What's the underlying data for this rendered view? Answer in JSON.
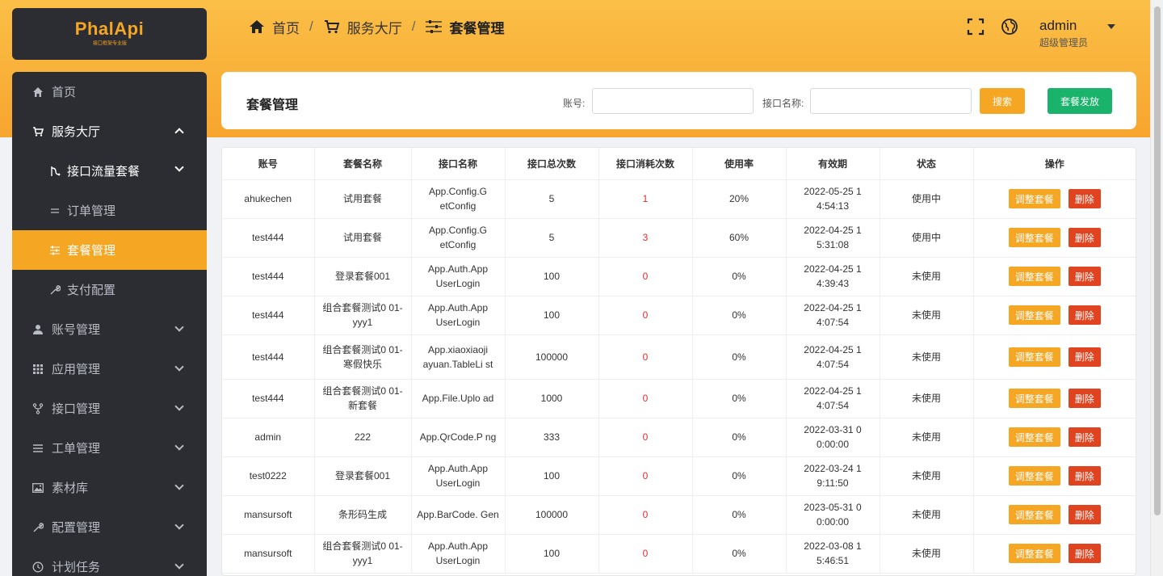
{
  "logo": {
    "main": "PhalApi",
    "sub": "接口框架专业版"
  },
  "menu": {
    "items": [
      {
        "label": "首页",
        "icon": "home-icon"
      },
      {
        "label": "服务大厅",
        "icon": "cart-icon"
      },
      {
        "label": "接口流量套餐",
        "icon": "flow-icon"
      },
      {
        "label": "订单管理",
        "icon": "lines-icon"
      },
      {
        "label": "套餐管理",
        "icon": "sliders-icon"
      },
      {
        "label": "支付配置",
        "icon": "wrench-icon"
      },
      {
        "label": "账号管理",
        "icon": "user-icon"
      },
      {
        "label": "应用管理",
        "icon": "grid-icon"
      },
      {
        "label": "接口管理",
        "icon": "branch-icon"
      },
      {
        "label": "工单管理",
        "icon": "list-icon"
      },
      {
        "label": "素材库",
        "icon": "image-icon"
      },
      {
        "label": "配置管理",
        "icon": "wrench-icon"
      },
      {
        "label": "计划任务",
        "icon": "clock-icon"
      }
    ]
  },
  "breadcrumb": {
    "home": "首页",
    "hall": "服务大厅",
    "current": "套餐管理",
    "sep": "/"
  },
  "user": {
    "name": "admin",
    "role": "超级管理员"
  },
  "card": {
    "title": "套餐管理",
    "account_label": "账号:",
    "api_label": "接口名称:",
    "account_value": "",
    "api_value": "",
    "search_btn": "搜索",
    "issue_btn": "套餐发放"
  },
  "table": {
    "headers": [
      "账号",
      "套餐名称",
      "接口名称",
      "接口总次数",
      "接口消耗次数",
      "使用率",
      "有效期",
      "状态",
      "操作"
    ],
    "adjust_label": "调整套餐",
    "delete_label": "删除",
    "rows": [
      {
        "account": "ahukechen",
        "plan": "试用套餐",
        "api": "App.Config.G etConfig",
        "total": "5",
        "used": "1",
        "rate": "20%",
        "expire": "2022-05-25 1 4:54:13",
        "status": "使用中"
      },
      {
        "account": "test444",
        "plan": "试用套餐",
        "api": "App.Config.G etConfig",
        "total": "5",
        "used": "3",
        "rate": "60%",
        "expire": "2022-04-25 1 5:31:08",
        "status": "使用中"
      },
      {
        "account": "test444",
        "plan": "登录套餐001",
        "api": "App.Auth.App UserLogin",
        "total": "100",
        "used": "0",
        "rate": "0%",
        "expire": "2022-04-25 1 4:39:43",
        "status": "未使用"
      },
      {
        "account": "test444",
        "plan": "组合套餐测试0 01-yyy1",
        "api": "App.Auth.App UserLogin",
        "total": "100",
        "used": "0",
        "rate": "0%",
        "expire": "2022-04-25 1 4:07:54",
        "status": "未使用"
      },
      {
        "account": "test444",
        "plan": "组合套餐测试0 01-寒假快乐",
        "api": "App.xiaoxiaoji ayuan.TableLi st",
        "total": "100000",
        "used": "0",
        "rate": "0%",
        "expire": "2022-04-25 1 4:07:54",
        "status": "未使用"
      },
      {
        "account": "test444",
        "plan": "组合套餐测试0 01-新套餐",
        "api": "App.File.Uplo ad",
        "total": "1000",
        "used": "0",
        "rate": "0%",
        "expire": "2022-04-25 1 4:07:54",
        "status": "未使用"
      },
      {
        "account": "admin",
        "plan": "222",
        "api": "App.QrCode.P ng",
        "total": "333",
        "used": "0",
        "rate": "0%",
        "expire": "2022-03-31 0 0:00:00",
        "status": "未使用"
      },
      {
        "account": "test0222",
        "plan": "登录套餐001",
        "api": "App.Auth.App UserLogin",
        "total": "100",
        "used": "0",
        "rate": "0%",
        "expire": "2022-03-24 1 9:11:50",
        "status": "未使用"
      },
      {
        "account": "mansursoft",
        "plan": "条形码生成",
        "api": "App.BarCode. Gen",
        "total": "100000",
        "used": "0",
        "rate": "0%",
        "expire": "2023-05-31 0 0:00:00",
        "status": "未使用"
      },
      {
        "account": "mansursoft",
        "plan": "组合套餐测试0 01-yyy1",
        "api": "App.Auth.App UserLogin",
        "total": "100",
        "used": "0",
        "rate": "0%",
        "expire": "2022-03-08 1 5:46:51",
        "status": "未使用"
      }
    ]
  }
}
